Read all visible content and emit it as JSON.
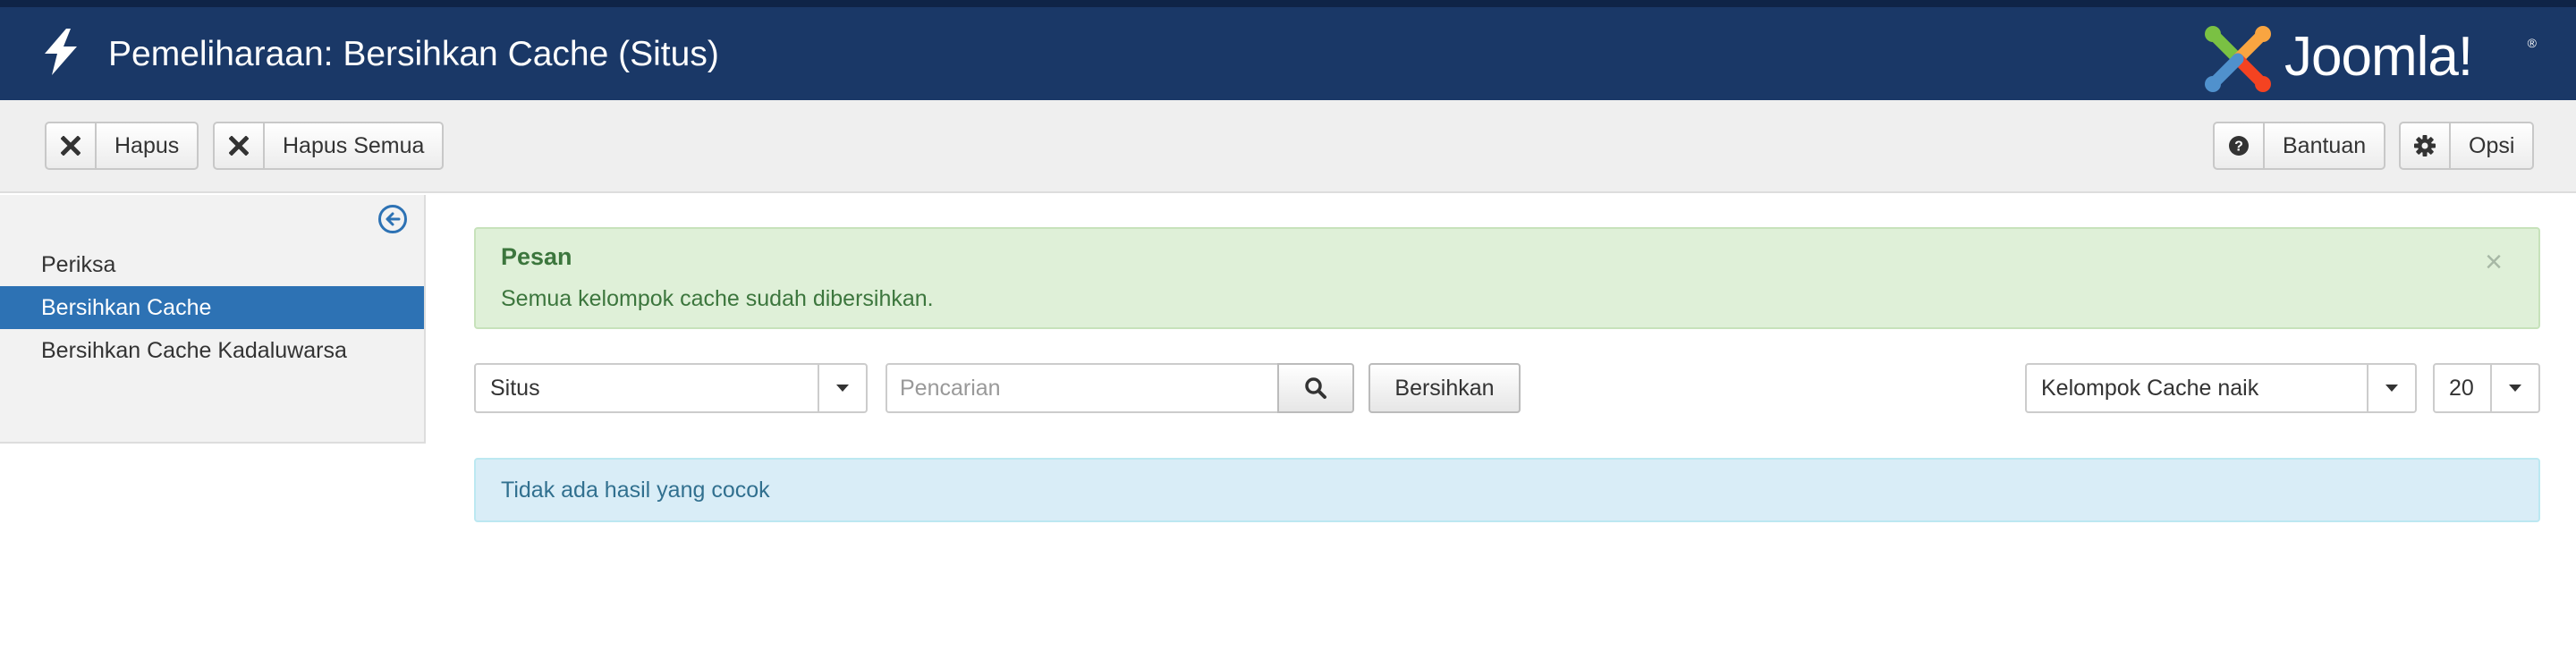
{
  "header": {
    "title": "Pemeliharaan: Bersihkan Cache (Situs)",
    "logo_text": "Joomla!",
    "logo_reg": "®",
    "bg_color": "#1a3867",
    "icon": "bolt-icon"
  },
  "toolbar": {
    "buttons": [
      {
        "label": "Hapus",
        "icon": "x-icon"
      },
      {
        "label": "Hapus Semua",
        "icon": "x-icon"
      },
      {
        "label": "Bantuan",
        "icon": "question-circle-icon"
      },
      {
        "label": "Opsi",
        "icon": "gear-icon"
      }
    ]
  },
  "sidebar": {
    "collapse_icon": "arrow-left-circle-icon",
    "items": [
      {
        "label": "Periksa",
        "active": false
      },
      {
        "label": "Bersihkan Cache",
        "active": true
      },
      {
        "label": "Bersihkan Cache Kadaluwarsa",
        "active": false
      }
    ],
    "active_color": "#2d72b4"
  },
  "message": {
    "heading": "Pesan",
    "text": "Semua kelompok cache sudah dibersihkan.",
    "close": "×",
    "bg_color": "#dff0d8",
    "text_color": "#3c763d"
  },
  "filters": {
    "client_select": {
      "value": "Situs"
    },
    "search": {
      "placeholder": "Pencarian",
      "value": ""
    },
    "clear_label": "Bersihkan",
    "ordering_select": {
      "value": "Kelompok Cache naik"
    },
    "limit_select": {
      "value": "20"
    }
  },
  "info": {
    "text": "Tidak ada hasil yang cocok",
    "bg_color": "#d9edf7",
    "text_color": "#31708f"
  }
}
